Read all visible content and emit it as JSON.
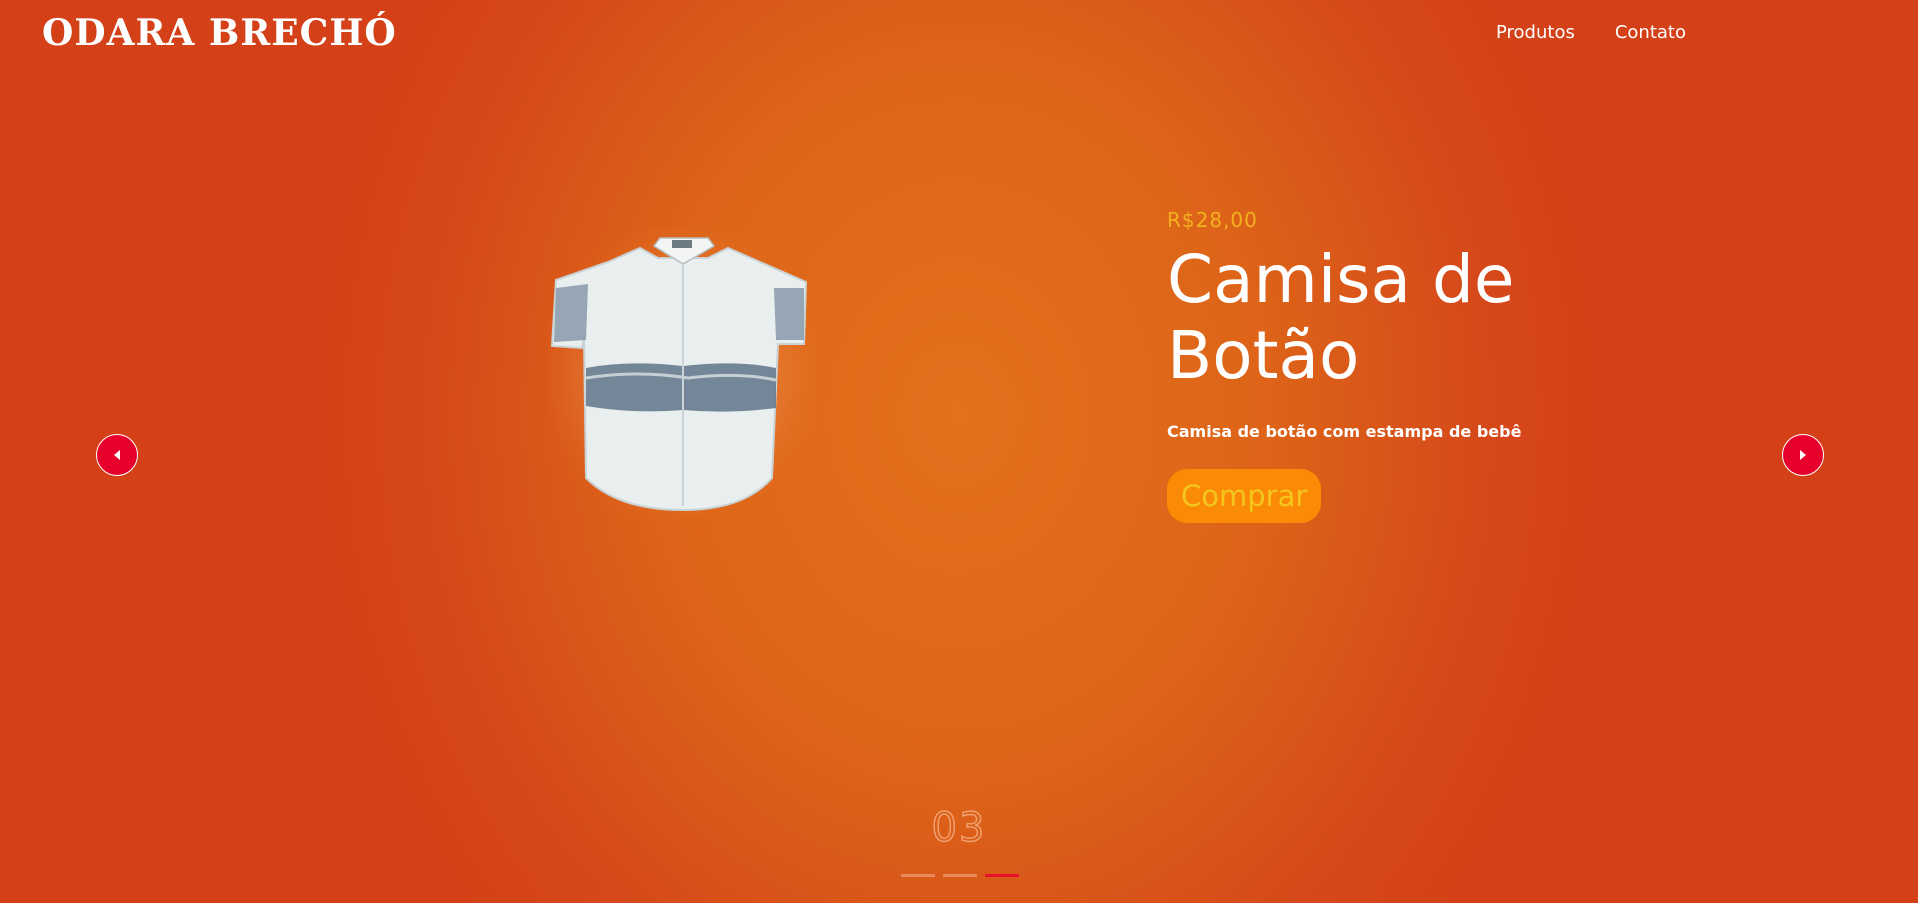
{
  "header": {
    "logo": "ODARA BRECHÓ",
    "nav": [
      {
        "label": "Produtos"
      },
      {
        "label": "Contato"
      }
    ]
  },
  "carousel": {
    "prev_icon": "caret-left-icon",
    "next_icon": "caret-right-icon",
    "slide_number": "03",
    "total_slides": 3,
    "active_slide": 3
  },
  "product": {
    "price": "R$28,00",
    "title_line1": "Camisa de",
    "title_line2": "Botão",
    "description": "Camisa de botão com estampa de bebê",
    "buy_label": "Comprar"
  },
  "colors": {
    "background": "#d6491a",
    "glow": "#e2701c",
    "price": "#f2b11f",
    "buy_button": "#fb8a06",
    "buy_text": "#f4c61c",
    "arrow": "#e8002d",
    "indicator_active": "#e8102a"
  }
}
